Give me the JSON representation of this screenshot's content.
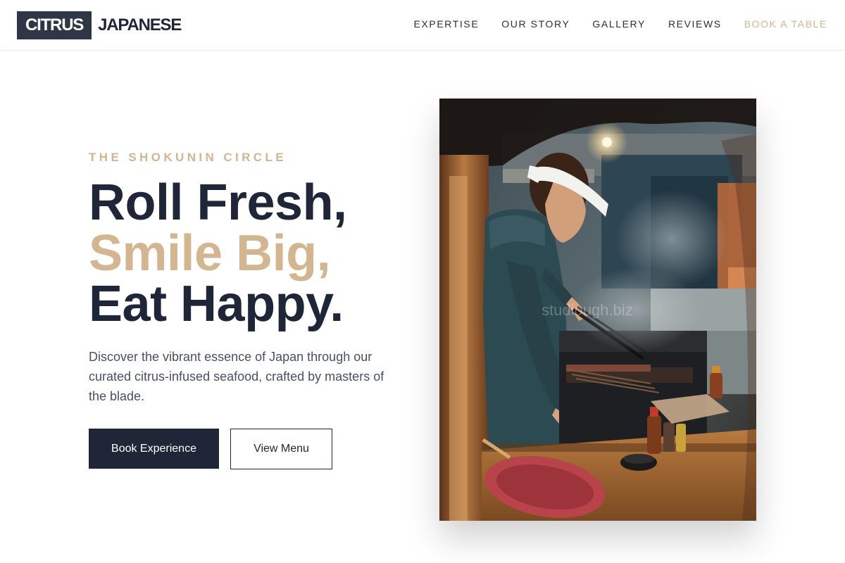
{
  "brand": {
    "box_text": "CITRUS",
    "word": "JAPANESE"
  },
  "nav": {
    "items": [
      {
        "label": "EXPERTISE"
      },
      {
        "label": "OUR STORY"
      },
      {
        "label": "GALLERY"
      },
      {
        "label": "REVIEWS"
      },
      {
        "label": "BOOK A TABLE"
      }
    ]
  },
  "hero": {
    "eyebrow": "THE SHOKUNIN CIRCLE",
    "headline": {
      "line1": "Roll Fresh,",
      "line2": "Smile Big,",
      "line3": "Eat Happy."
    },
    "description": "Discover the vibrant essence of Japan through our curated citrus-infused seafood, crafted by masters of the blade.",
    "primary_button": "Book Experience",
    "secondary_button": "View Menu"
  },
  "photo": {
    "watermark": "studiough.biz"
  },
  "colors": {
    "navy": "#1e2638",
    "gold": "#d3b58f",
    "logo_bg": "#2f3747",
    "body_text": "#475064"
  },
  "icons": []
}
